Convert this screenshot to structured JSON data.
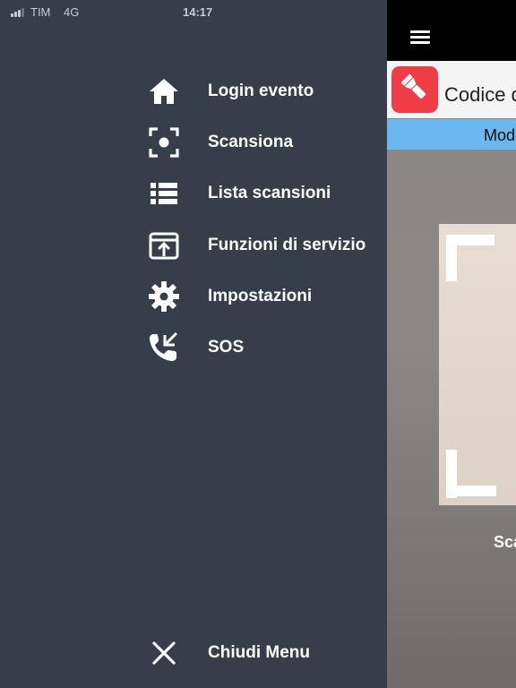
{
  "status_bar": {
    "carrier": "TIM",
    "network": "4G",
    "time": "14:17"
  },
  "menu": {
    "items": [
      {
        "label": "Login evento",
        "icon": "home-icon"
      },
      {
        "label": "Scansiona",
        "icon": "scan-focus-icon"
      },
      {
        "label": "Lista scansioni",
        "icon": "list-icon"
      },
      {
        "label": "Funzioni di servizio",
        "icon": "upload-box-icon"
      },
      {
        "label": "Impostazioni",
        "icon": "gear-icon"
      },
      {
        "label": "SOS",
        "icon": "phone-call-icon"
      }
    ],
    "close": {
      "label": "Chiudi Menu",
      "icon": "close-icon"
    }
  },
  "content": {
    "code_label": "Codice d",
    "mode_label": "Mod",
    "scan_label": "Sca"
  },
  "colors": {
    "drawer_bg": "#363e4b",
    "flash_button": "#ef3d48",
    "mode_bar": "#6cb7ee",
    "topbar": "#000000"
  }
}
